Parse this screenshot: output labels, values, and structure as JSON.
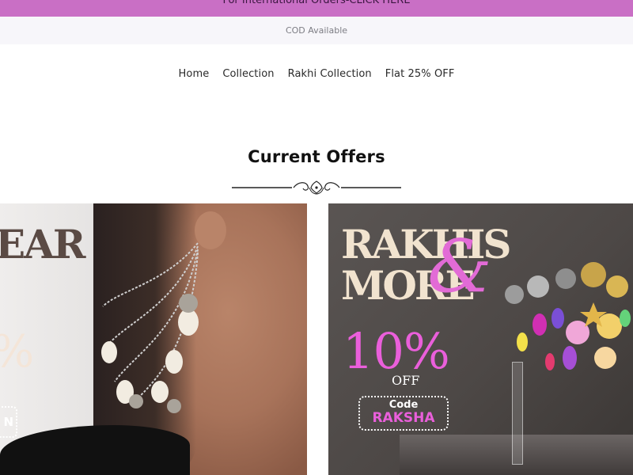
{
  "announcement": {
    "text": "For International Orders-CLICK HERE"
  },
  "cod_bar": {
    "text": "COD Available"
  },
  "nav": {
    "items": [
      {
        "label": "Home"
      },
      {
        "label": "Collection"
      },
      {
        "label": "Rakhi Collection"
      },
      {
        "label": "Flat 25% OFF"
      }
    ]
  },
  "offers": {
    "title": "Current Offers",
    "cards": [
      {
        "headline": "EAR",
        "percent": "%",
        "badge": "N"
      },
      {
        "headline_line1": "RAKHIS",
        "headline_line2": "MORE",
        "ampersand": "&",
        "percent": "10%",
        "off": "OFF",
        "code_label": "Code",
        "code_value": "RAKSHA"
      }
    ]
  },
  "colors": {
    "announcement_bg": "#c96fc5",
    "cod_bg": "#f7f6fa",
    "accent_pink": "#ea5fdb"
  }
}
